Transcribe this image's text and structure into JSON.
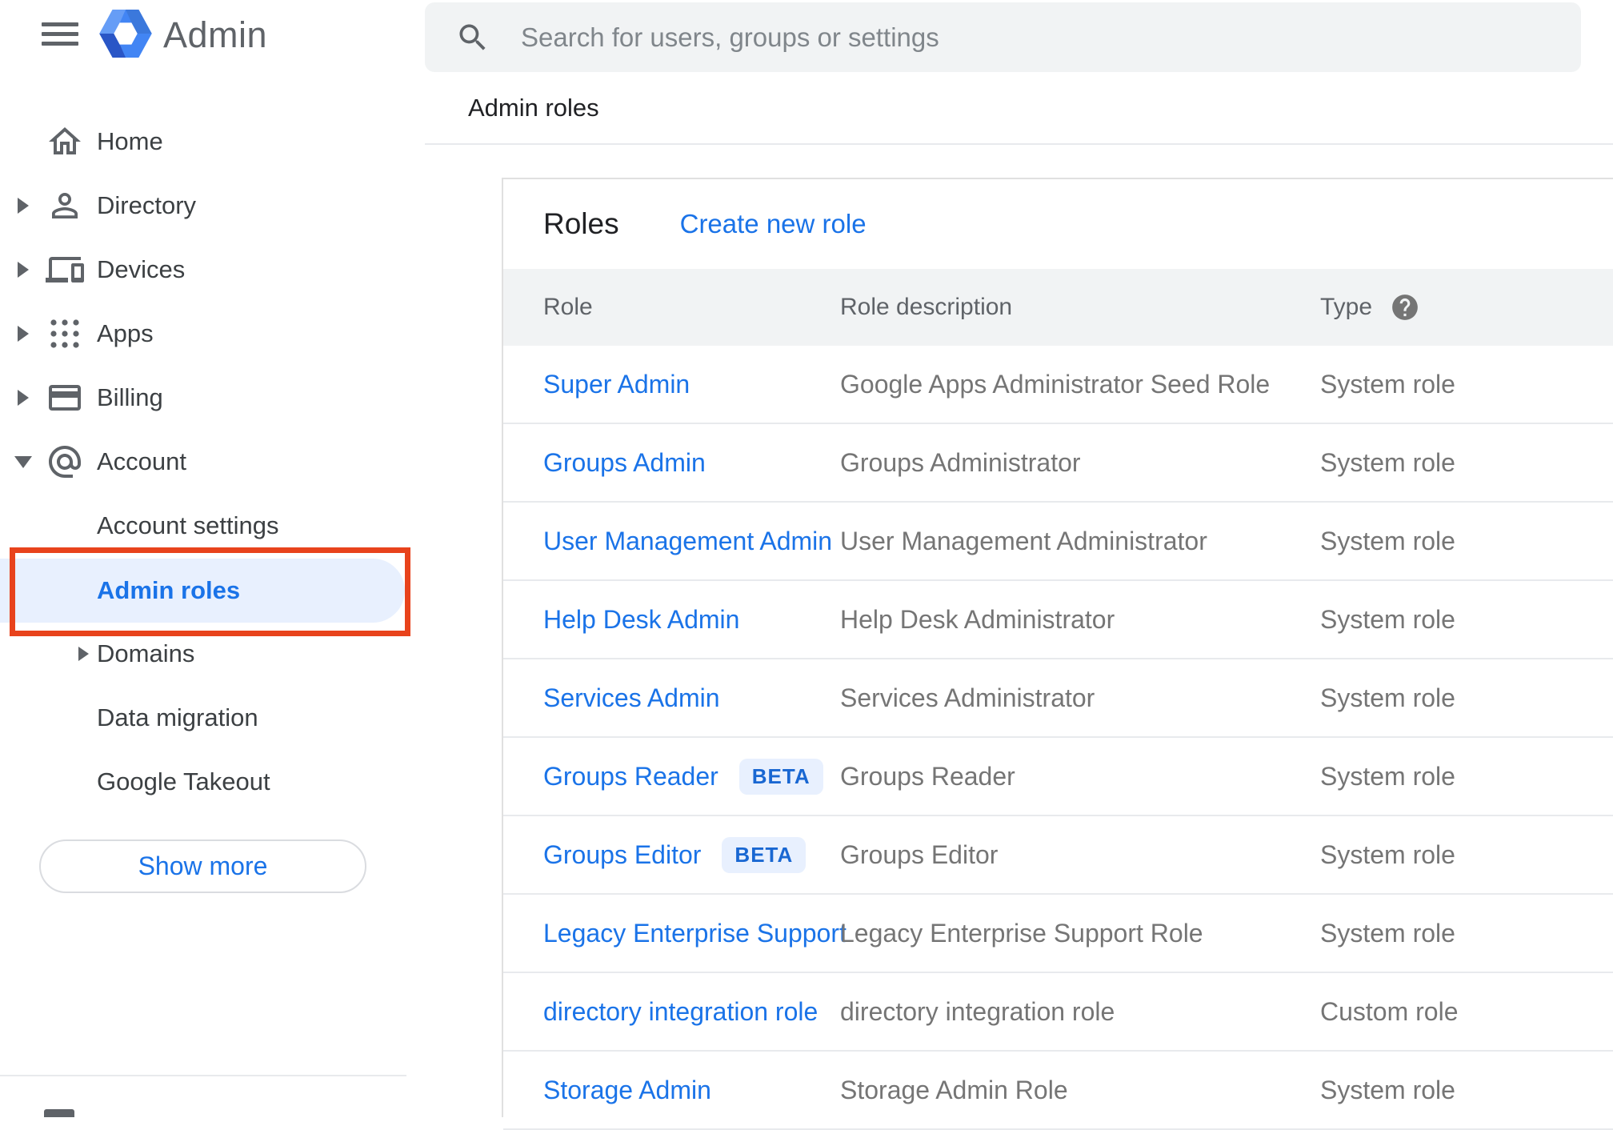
{
  "app": {
    "name": "Admin"
  },
  "search": {
    "placeholder": "Search for users, groups or settings"
  },
  "breadcrumb": "Admin roles",
  "sidebar": {
    "items": [
      {
        "label": "Home",
        "icon": "home-icon",
        "level": 0,
        "expandable": false
      },
      {
        "label": "Directory",
        "icon": "person-icon",
        "level": 0,
        "expandable": true
      },
      {
        "label": "Devices",
        "icon": "devices-icon",
        "level": 0,
        "expandable": true
      },
      {
        "label": "Apps",
        "icon": "apps-grid-icon",
        "level": 0,
        "expandable": true
      },
      {
        "label": "Billing",
        "icon": "credit-card-icon",
        "level": 0,
        "expandable": true
      },
      {
        "label": "Account",
        "icon": "at-sign-icon",
        "level": 0,
        "expandable": true,
        "expanded": true
      },
      {
        "label": "Account settings",
        "level": 1
      },
      {
        "label": "Admin roles",
        "level": 1,
        "active": true,
        "annotated": true
      },
      {
        "label": "Domains",
        "level": 1,
        "expandable": true
      },
      {
        "label": "Data migration",
        "level": 1
      },
      {
        "label": "Google Takeout",
        "level": 1
      }
    ],
    "show_more_label": "Show more"
  },
  "annotation": {
    "shape": "red-box",
    "target": "Admin roles",
    "color": "#e8431c"
  },
  "panel": {
    "title": "Roles",
    "action": "Create new role",
    "columns": [
      "Role",
      "Role description",
      "Type"
    ],
    "rows": [
      {
        "role": "Super Admin",
        "beta": false,
        "description": "Google Apps Administrator Seed Role",
        "type": "System role"
      },
      {
        "role": "Groups Admin",
        "beta": false,
        "description": "Groups Administrator",
        "type": "System role"
      },
      {
        "role": "User Management Admin",
        "beta": false,
        "description": "User Management Administrator",
        "type": "System role"
      },
      {
        "role": "Help Desk Admin",
        "beta": false,
        "description": "Help Desk Administrator",
        "type": "System role"
      },
      {
        "role": "Services Admin",
        "beta": false,
        "description": "Services Administrator",
        "type": "System role"
      },
      {
        "role": "Groups Reader",
        "beta": true,
        "beta_label": "BETA",
        "description": "Groups Reader",
        "type": "System role"
      },
      {
        "role": "Groups Editor",
        "beta": true,
        "beta_label": "BETA",
        "description": "Groups Editor",
        "type": "System role"
      },
      {
        "role": "Legacy Enterprise Support",
        "beta": false,
        "description": "Legacy Enterprise Support Role",
        "type": "System role"
      },
      {
        "role": "directory integration role",
        "beta": false,
        "description": "directory integration role",
        "type": "Custom role"
      },
      {
        "role": "Storage Admin",
        "beta": false,
        "description": "Storage Admin Role",
        "type": "System role"
      }
    ]
  },
  "colors": {
    "accent": "#1a73e8",
    "beta_text": "#1967d2",
    "chip_bg": "#e8f0fe",
    "annotation": "#e8431c",
    "logo_blue": "#4285f4"
  }
}
